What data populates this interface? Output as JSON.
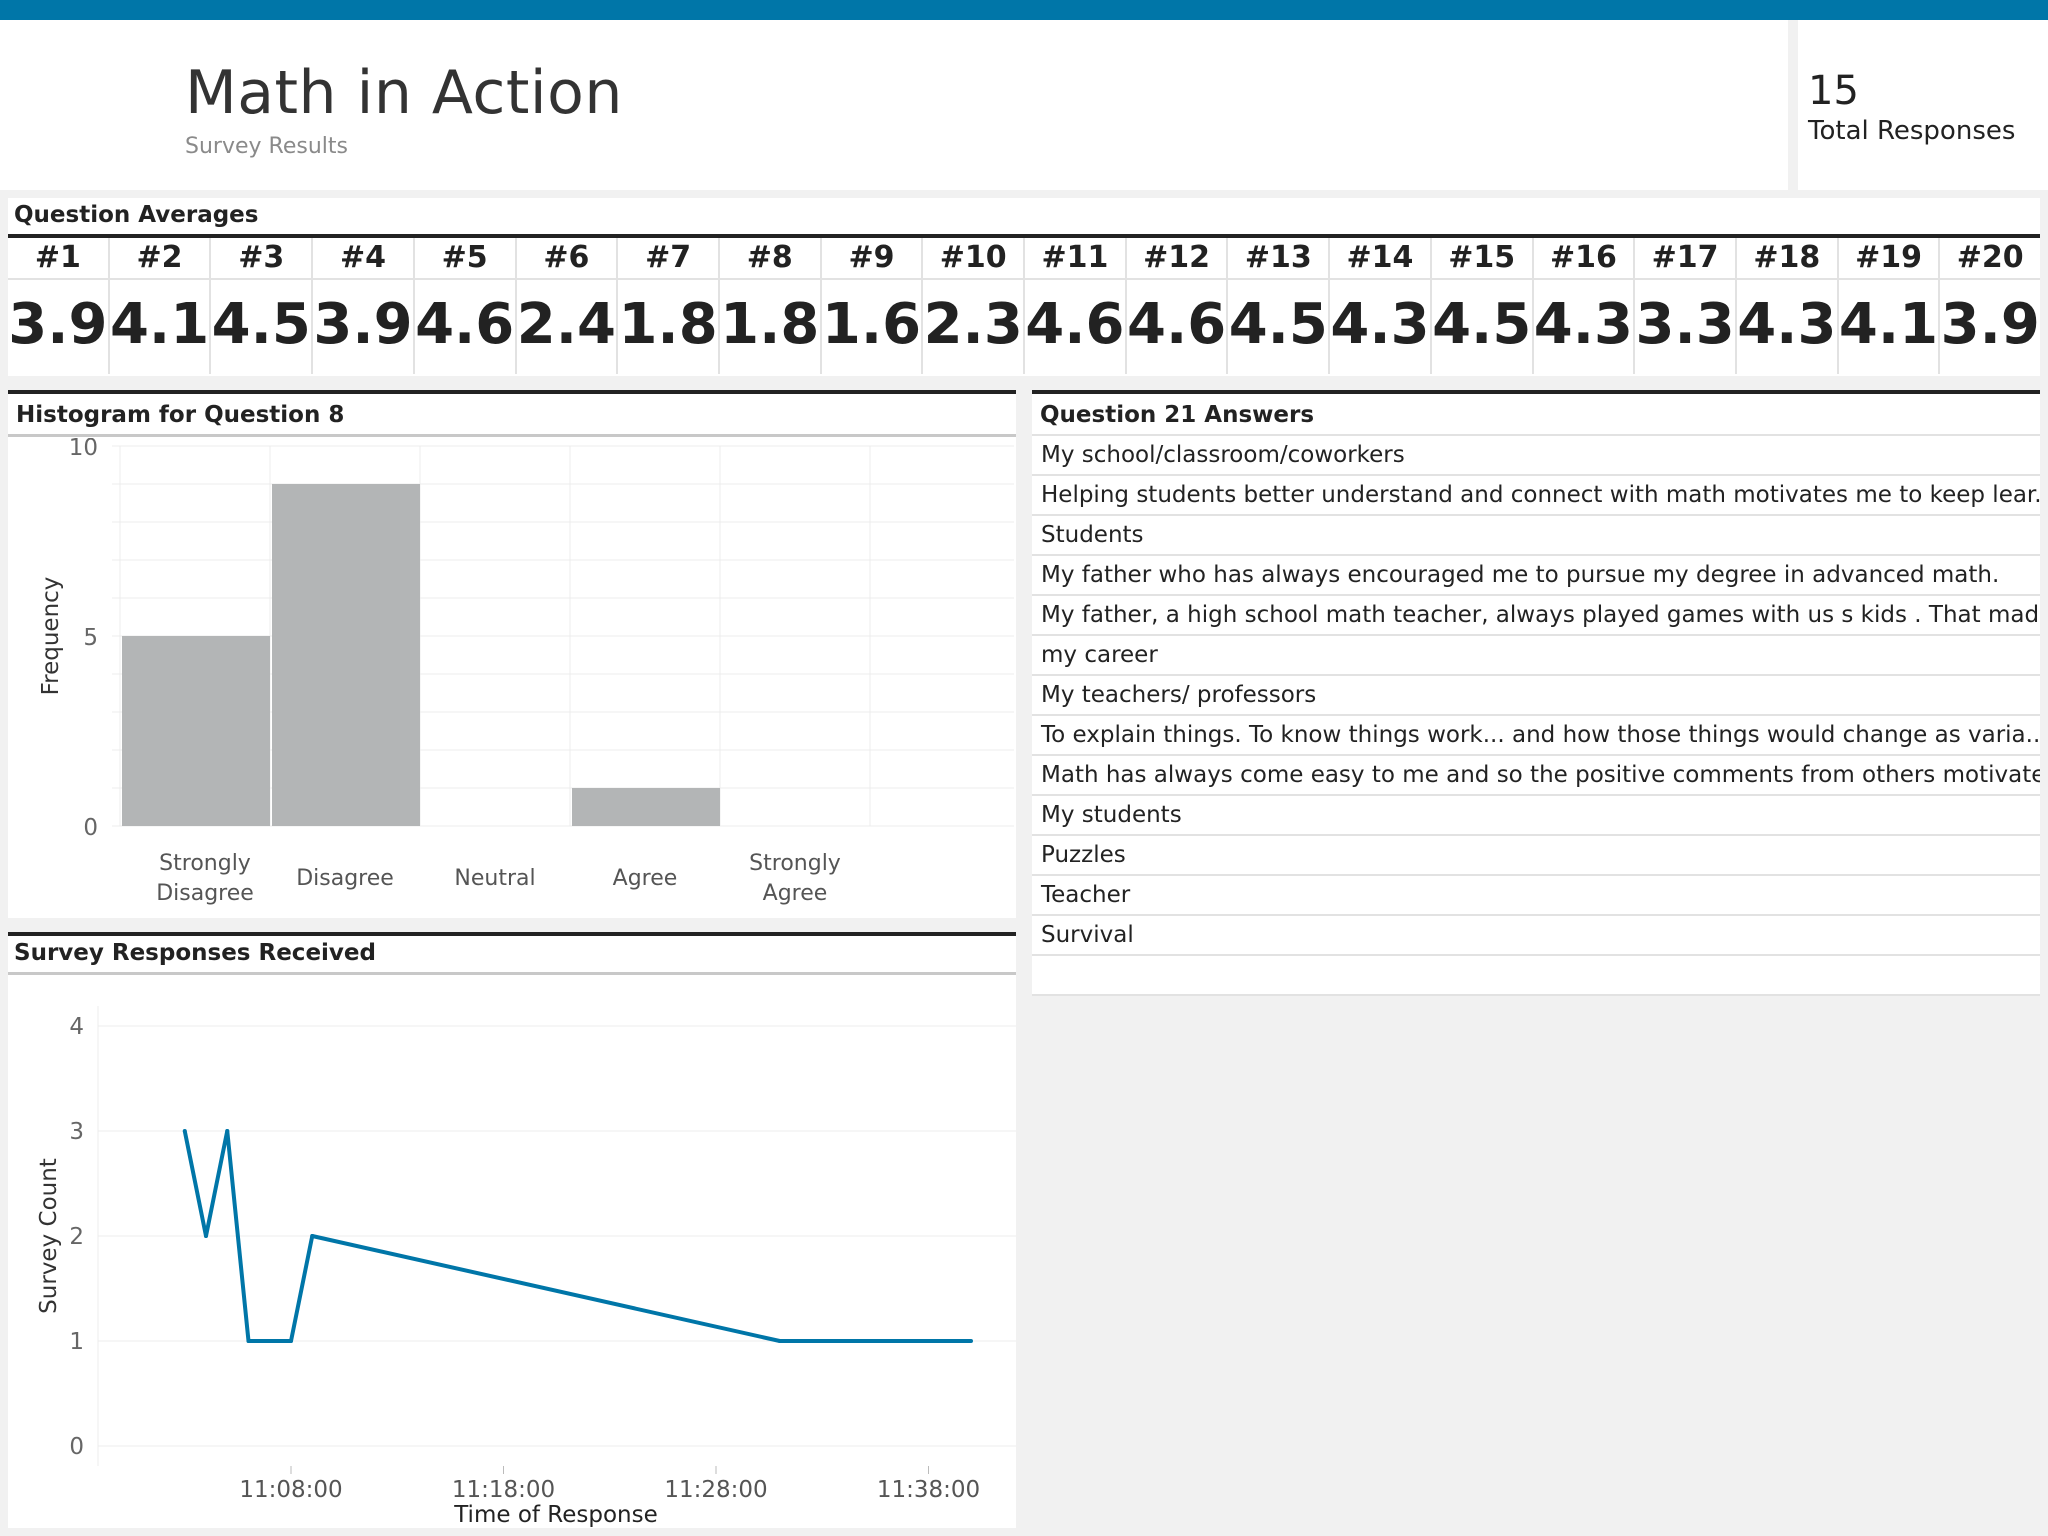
{
  "header": {
    "title": "Math in Action",
    "subtitle": "Survey Results",
    "kpi_value": "15",
    "kpi_label": "Total Responses"
  },
  "averages": {
    "title": "Question Averages",
    "items": [
      {
        "label": "#1",
        "value": "3.9"
      },
      {
        "label": "#2",
        "value": "4.1"
      },
      {
        "label": "#3",
        "value": "4.5"
      },
      {
        "label": "#4",
        "value": "3.9"
      },
      {
        "label": "#5",
        "value": "4.6"
      },
      {
        "label": "#6",
        "value": "2.4"
      },
      {
        "label": "#7",
        "value": "1.8"
      },
      {
        "label": "#8",
        "value": "1.8"
      },
      {
        "label": "#9",
        "value": "1.6"
      },
      {
        "label": "#10",
        "value": "2.3"
      },
      {
        "label": "#11",
        "value": "4.6"
      },
      {
        "label": "#12",
        "value": "4.6"
      },
      {
        "label": "#13",
        "value": "4.5"
      },
      {
        "label": "#14",
        "value": "4.3"
      },
      {
        "label": "#15",
        "value": "4.5"
      },
      {
        "label": "#16",
        "value": "4.3"
      },
      {
        "label": "#17",
        "value": "3.3"
      },
      {
        "label": "#18",
        "value": "4.3"
      },
      {
        "label": "#19",
        "value": "4.1"
      },
      {
        "label": "#20",
        "value": "3.9"
      }
    ]
  },
  "chart_data": [
    {
      "type": "bar",
      "title": "Histogram for Question 8",
      "categories": [
        "Strongly Disagree",
        "Disagree",
        "Neutral",
        "Agree",
        "Strongly Agree"
      ],
      "values": [
        5,
        9,
        0,
        1,
        0
      ],
      "xlabel": "",
      "ylabel": "Frequency",
      "ylim": [
        0,
        10
      ],
      "yticks": [
        0,
        5,
        10
      ],
      "bar_color": "#b3b5b6",
      "grid": true
    },
    {
      "type": "line",
      "title": "Survey Responses Received",
      "x": [
        "11:03:00",
        "11:04:00",
        "11:05:00",
        "11:06:00",
        "11:08:00",
        "11:09:00",
        "11:31:00",
        "11:40:00"
      ],
      "values": [
        3,
        2,
        3,
        1,
        1,
        2,
        1,
        1
      ],
      "xlabel": "Time of Response",
      "ylabel": "Survey Count",
      "ylim": [
        0,
        4
      ],
      "yticks": [
        0,
        1,
        2,
        3,
        4
      ],
      "xticks": [
        "11:08:00",
        "11:18:00",
        "11:28:00",
        "11:38:00"
      ],
      "line_color": "#0076a8",
      "grid": true
    }
  ],
  "q21": {
    "title": "Question 21 Answers",
    "answers": [
      "My school/classroom/coworkers",
      "Helping students better understand and connect with math motivates me to keep lear..",
      "Students",
      "My father who has always encouraged me to pursue my degree in advanced math.",
      "My father, a high school math teacher, always played games with us s kids . That made..",
      "my career",
      "My teachers/ professors",
      "To explain things.  To know things work... and how those things would change as varia..",
      "Math has always come easy to me and so the positive comments from others motivate..",
      "My students",
      "Puzzles",
      "Teacher",
      "Survival",
      ""
    ]
  }
}
